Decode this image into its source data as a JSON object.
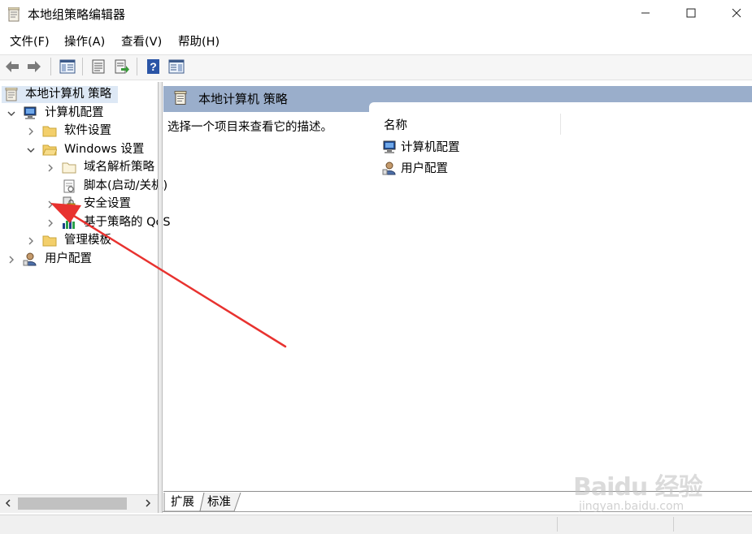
{
  "window": {
    "title": "本地组策略编辑器",
    "minimize_icon": "minimize-icon",
    "maximize_icon": "maximize-icon",
    "close_icon": "close-icon"
  },
  "menu": [
    "文件(F)",
    "操作(A)",
    "查看(V)",
    "帮助(H)"
  ],
  "toolbar": [
    "back-arrow-icon",
    "forward-arrow-icon",
    "show-hide-tree-icon",
    "properties-icon",
    "export-list-icon",
    "help-icon",
    "show-hide-action-pane-icon"
  ],
  "tree": {
    "root": "本地计算机 策略",
    "computer_config": "计算机配置",
    "software_settings": "软件设置",
    "windows_settings": "Windows 设置",
    "name_resolution_policy": "域名解析策略",
    "scripts": "脚本(启动/关机)",
    "security_settings": "安全设置",
    "policy_based_qos": "基于策略的 QoS",
    "admin_templates": "管理模板",
    "user_config": "用户配置"
  },
  "right": {
    "header_title": "本地计算机 策略",
    "description": "选择一个项目来查看它的描述。",
    "column_name": "名称",
    "items": [
      "计算机配置",
      "用户配置"
    ]
  },
  "tabs": [
    "扩展",
    "标准"
  ],
  "watermark": {
    "logo": "Baidu 经验",
    "url": "jingyan.baidu.com"
  },
  "colors": {
    "header_bg": "#9aaecb",
    "selected_bg": "#dde8f5",
    "arrow": "#e8322f"
  }
}
